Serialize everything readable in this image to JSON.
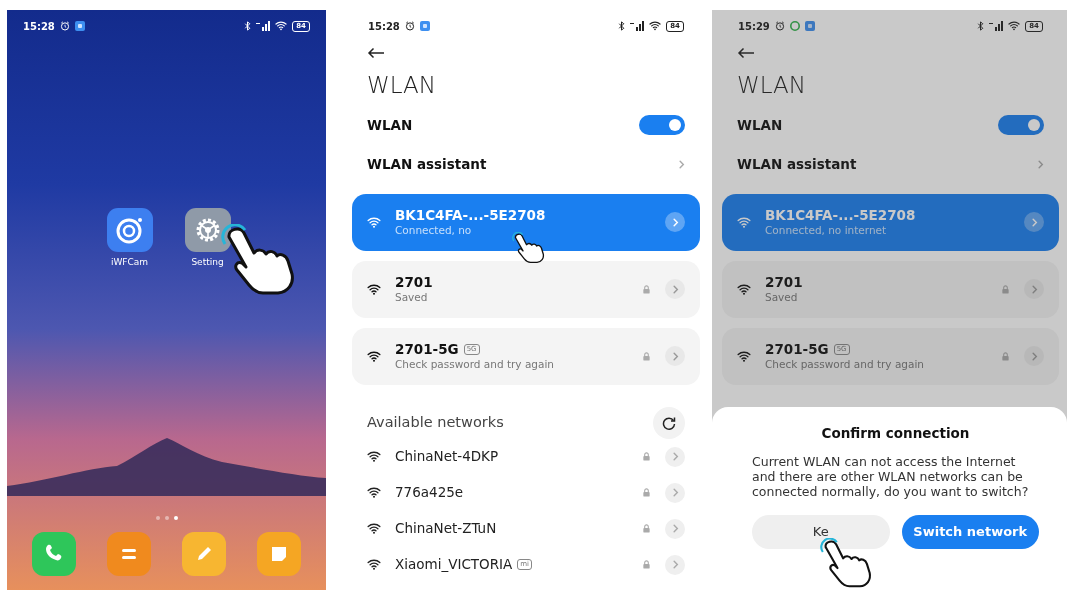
{
  "screens": [
    {
      "kind": "home",
      "status": {
        "time": "15:28",
        "battery": "84",
        "notification_icons": [
          {
            "kind": "alarm"
          },
          {
            "kind": "app"
          }
        ]
      },
      "apps": [
        {
          "label": "iWFCam",
          "kind": "camera"
        },
        {
          "label": "Setting",
          "kind": "gear"
        }
      ],
      "page_dots": [
        {
          "selected": false
        },
        {
          "selected": false
        },
        {
          "selected": true
        }
      ],
      "dock": [
        {
          "kind": "phone"
        },
        {
          "kind": "menu"
        },
        {
          "kind": "pencil"
        },
        {
          "kind": "note"
        }
      ]
    },
    {
      "kind": "wlan",
      "status": {
        "time": "15:28",
        "battery": "84",
        "notification_icons": [
          {
            "kind": "alarm"
          },
          {
            "kind": "app"
          }
        ]
      },
      "title": "WLAN",
      "wlan_toggle": {
        "label": "WLAN",
        "on": true
      },
      "assistant": "WLAN assistant",
      "saved_networks": [
        {
          "name": "BK1C4FA-...-5E2708",
          "detail": "Connected, no",
          "selected": true,
          "locked": false
        },
        {
          "name": "2701",
          "detail": "Saved",
          "selected": false,
          "locked": true
        },
        {
          "name": "2701-5G",
          "badge": "5G",
          "detail": "Check password and try again",
          "selected": false,
          "locked": true
        }
      ],
      "available_heading": "Available networks",
      "available_networks": [
        {
          "name": "ChinaNet-4DKP",
          "locked": true
        },
        {
          "name": "776a425e",
          "locked": true
        },
        {
          "name": "ChinaNet-ZTuN",
          "locked": true
        },
        {
          "name": "Xiaomi_VICTORIA",
          "badge": "mi",
          "locked": true
        }
      ]
    },
    {
      "kind": "wlan",
      "dimmed": true,
      "status": {
        "time": "15:29",
        "battery": "84",
        "notification_icons": [
          {
            "kind": "alarm"
          },
          {
            "kind": "circle-app"
          },
          {
            "kind": "app"
          }
        ]
      },
      "title": "WLAN",
      "wlan_toggle": {
        "label": "WLAN",
        "on": true
      },
      "assistant": "WLAN assistant",
      "saved_networks": [
        {
          "name": "BK1C4FA-...-5E2708",
          "detail": "Connected, no internet",
          "selected": true,
          "locked": false
        },
        {
          "name": "2701",
          "detail": "Saved",
          "selected": false,
          "locked": true
        },
        {
          "name": "2701-5G",
          "badge": "5G",
          "detail": "Check password and try again",
          "selected": false,
          "locked": true
        }
      ],
      "dialog": {
        "title": "Confirm connection",
        "message": "Current WLAN can not access the Internet and there are other WLAN networks can be connected normally, do you want to switch?",
        "buttons": [
          {
            "label": "Ke",
            "kind": "secondary"
          },
          {
            "label": "Switch network",
            "kind": "primary"
          }
        ]
      }
    }
  ]
}
